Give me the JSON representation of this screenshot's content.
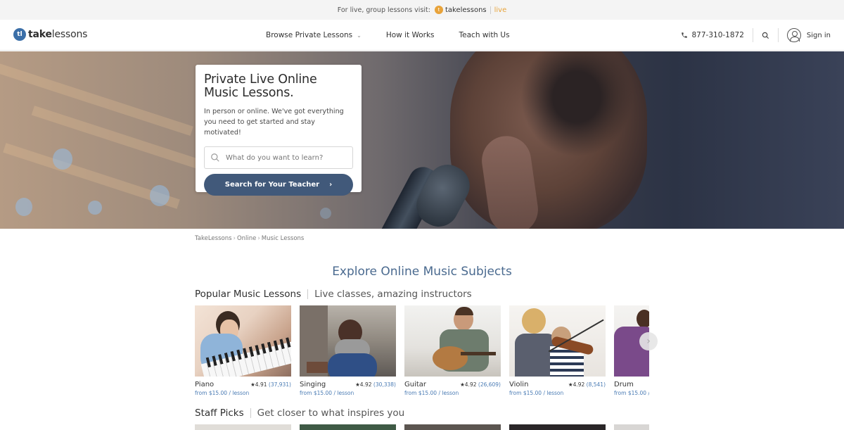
{
  "promo": {
    "text": "For live, group lessons visit:",
    "logo": "takelessons",
    "live": "live"
  },
  "brand": {
    "mark": "tl",
    "name_bold": "take",
    "name_rest": "lessons"
  },
  "nav": {
    "browse": "Browse Private Lessons",
    "how": "How it Works",
    "teach": "Teach with Us"
  },
  "header": {
    "phone": "877-310-1872",
    "signin": "Sign in"
  },
  "hero": {
    "title": "Private Live Online Music Lessons.",
    "subtitle": "In person or online. We've got everything you need to get started and stay motivated!",
    "search_placeholder": "What do you want to learn?",
    "search_button": "Search for Your Teacher"
  },
  "breadcrumb": [
    "TakeLessons",
    "Online",
    "Music Lessons"
  ],
  "explore_title": "Explore Online Music Subjects",
  "popular": {
    "title": "Popular Music Lessons",
    "subtitle": "Live classes, amazing instructors",
    "items": [
      {
        "name": "Piano",
        "rating": "★4.91",
        "count": "(37,931)",
        "price": "from $15.00 / lesson"
      },
      {
        "name": "Singing",
        "rating": "★4.92",
        "count": "(30,338)",
        "price": "from $15.00 / lesson"
      },
      {
        "name": "Guitar",
        "rating": "★4.92",
        "count": "(26,609)",
        "price": "from $15.00 / lesson"
      },
      {
        "name": "Violin",
        "rating": "★4.92",
        "count": "(8,541)",
        "price": "from $15.00 / lesson"
      },
      {
        "name": "Drum",
        "rating": "",
        "count": "",
        "price": "from $15.00 / l"
      }
    ]
  },
  "staff": {
    "title": "Staff Picks",
    "subtitle": "Get closer to what inspires you"
  },
  "colors": {
    "accent": "#41597a",
    "link": "#4a7bb4",
    "heading": "#4a6a8f",
    "live": "#e8a33a"
  },
  "icons": {
    "phone": "phone-icon",
    "search": "search-icon",
    "user": "user-icon",
    "next": "chevron-right-icon"
  }
}
